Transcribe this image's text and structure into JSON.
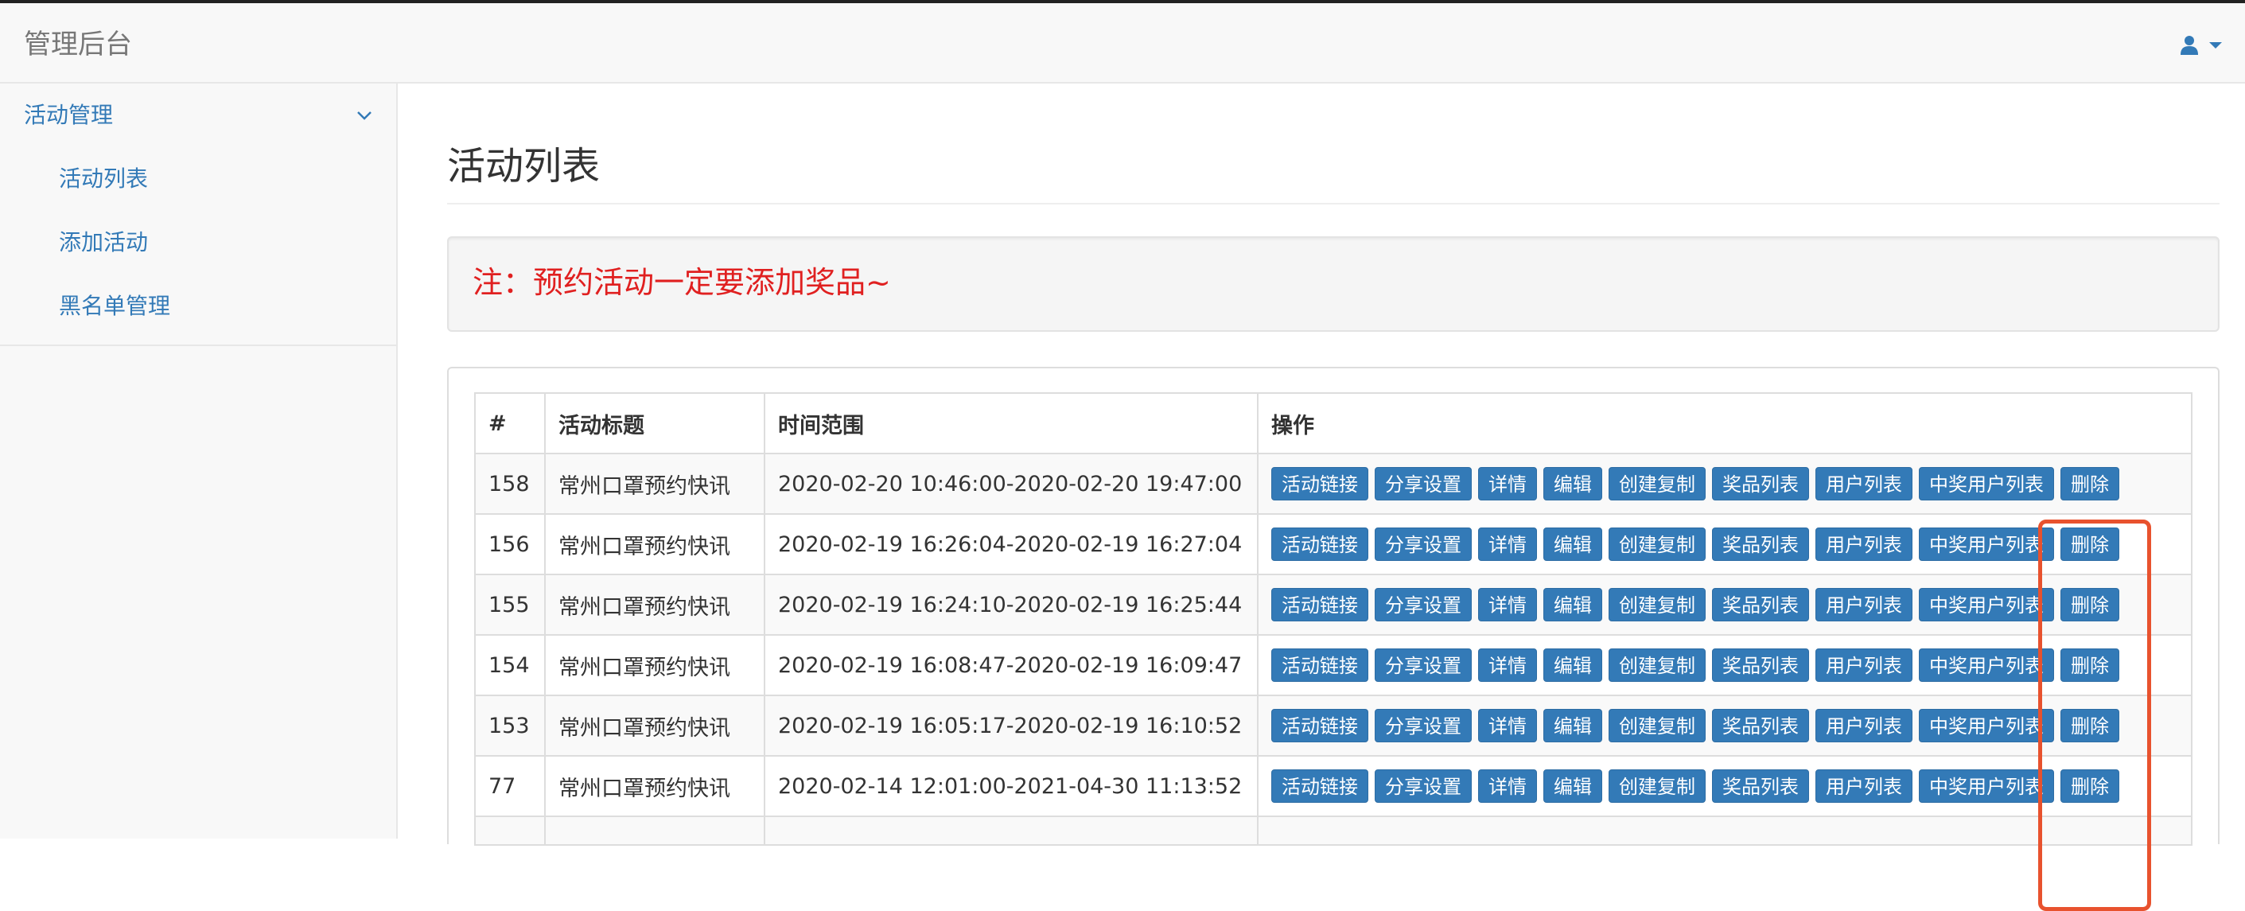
{
  "app": {
    "brand": "管理后台",
    "user_icon": "user-icon",
    "caret_icon": "caret-down-icon"
  },
  "sidebar": {
    "group": {
      "label": "活动管理",
      "icon": "chevron-down-icon"
    },
    "items": [
      {
        "label": "活动列表"
      },
      {
        "label": "添加活动"
      },
      {
        "label": "黑名单管理"
      }
    ]
  },
  "main": {
    "title": "活动列表",
    "notice": "注：预约活动一定要添加奖品~"
  },
  "table": {
    "headers": [
      "#",
      "活动标题",
      "时间范围",
      "操作"
    ],
    "actions": [
      "活动链接",
      "分享设置",
      "详情",
      "编辑",
      "创建复制",
      "奖品列表",
      "用户列表",
      "中奖用户列表",
      "删除"
    ],
    "rows": [
      {
        "id": "158",
        "title": "常州口罩预约快讯",
        "range": "2020-02-20 10:46:00-2020-02-20 19:47:00"
      },
      {
        "id": "156",
        "title": "常州口罩预约快讯",
        "range": "2020-02-19 16:26:04-2020-02-19 16:27:04"
      },
      {
        "id": "155",
        "title": "常州口罩预约快讯",
        "range": "2020-02-19 16:24:10-2020-02-19 16:25:44"
      },
      {
        "id": "154",
        "title": "常州口罩预约快讯",
        "range": "2020-02-19 16:08:47-2020-02-19 16:09:47"
      },
      {
        "id": "153",
        "title": "常州口罩预约快讯",
        "range": "2020-02-19 16:05:17-2020-02-19 16:10:52"
      },
      {
        "id": "77",
        "title": "常州口罩预约快讯",
        "range": "2020-02-14 12:01:00-2021-04-30 11:13:52"
      }
    ]
  },
  "colors": {
    "link": "#337ab7",
    "button": "#337ab7",
    "notice_text": "#e02020",
    "highlight": "#e8522e"
  }
}
